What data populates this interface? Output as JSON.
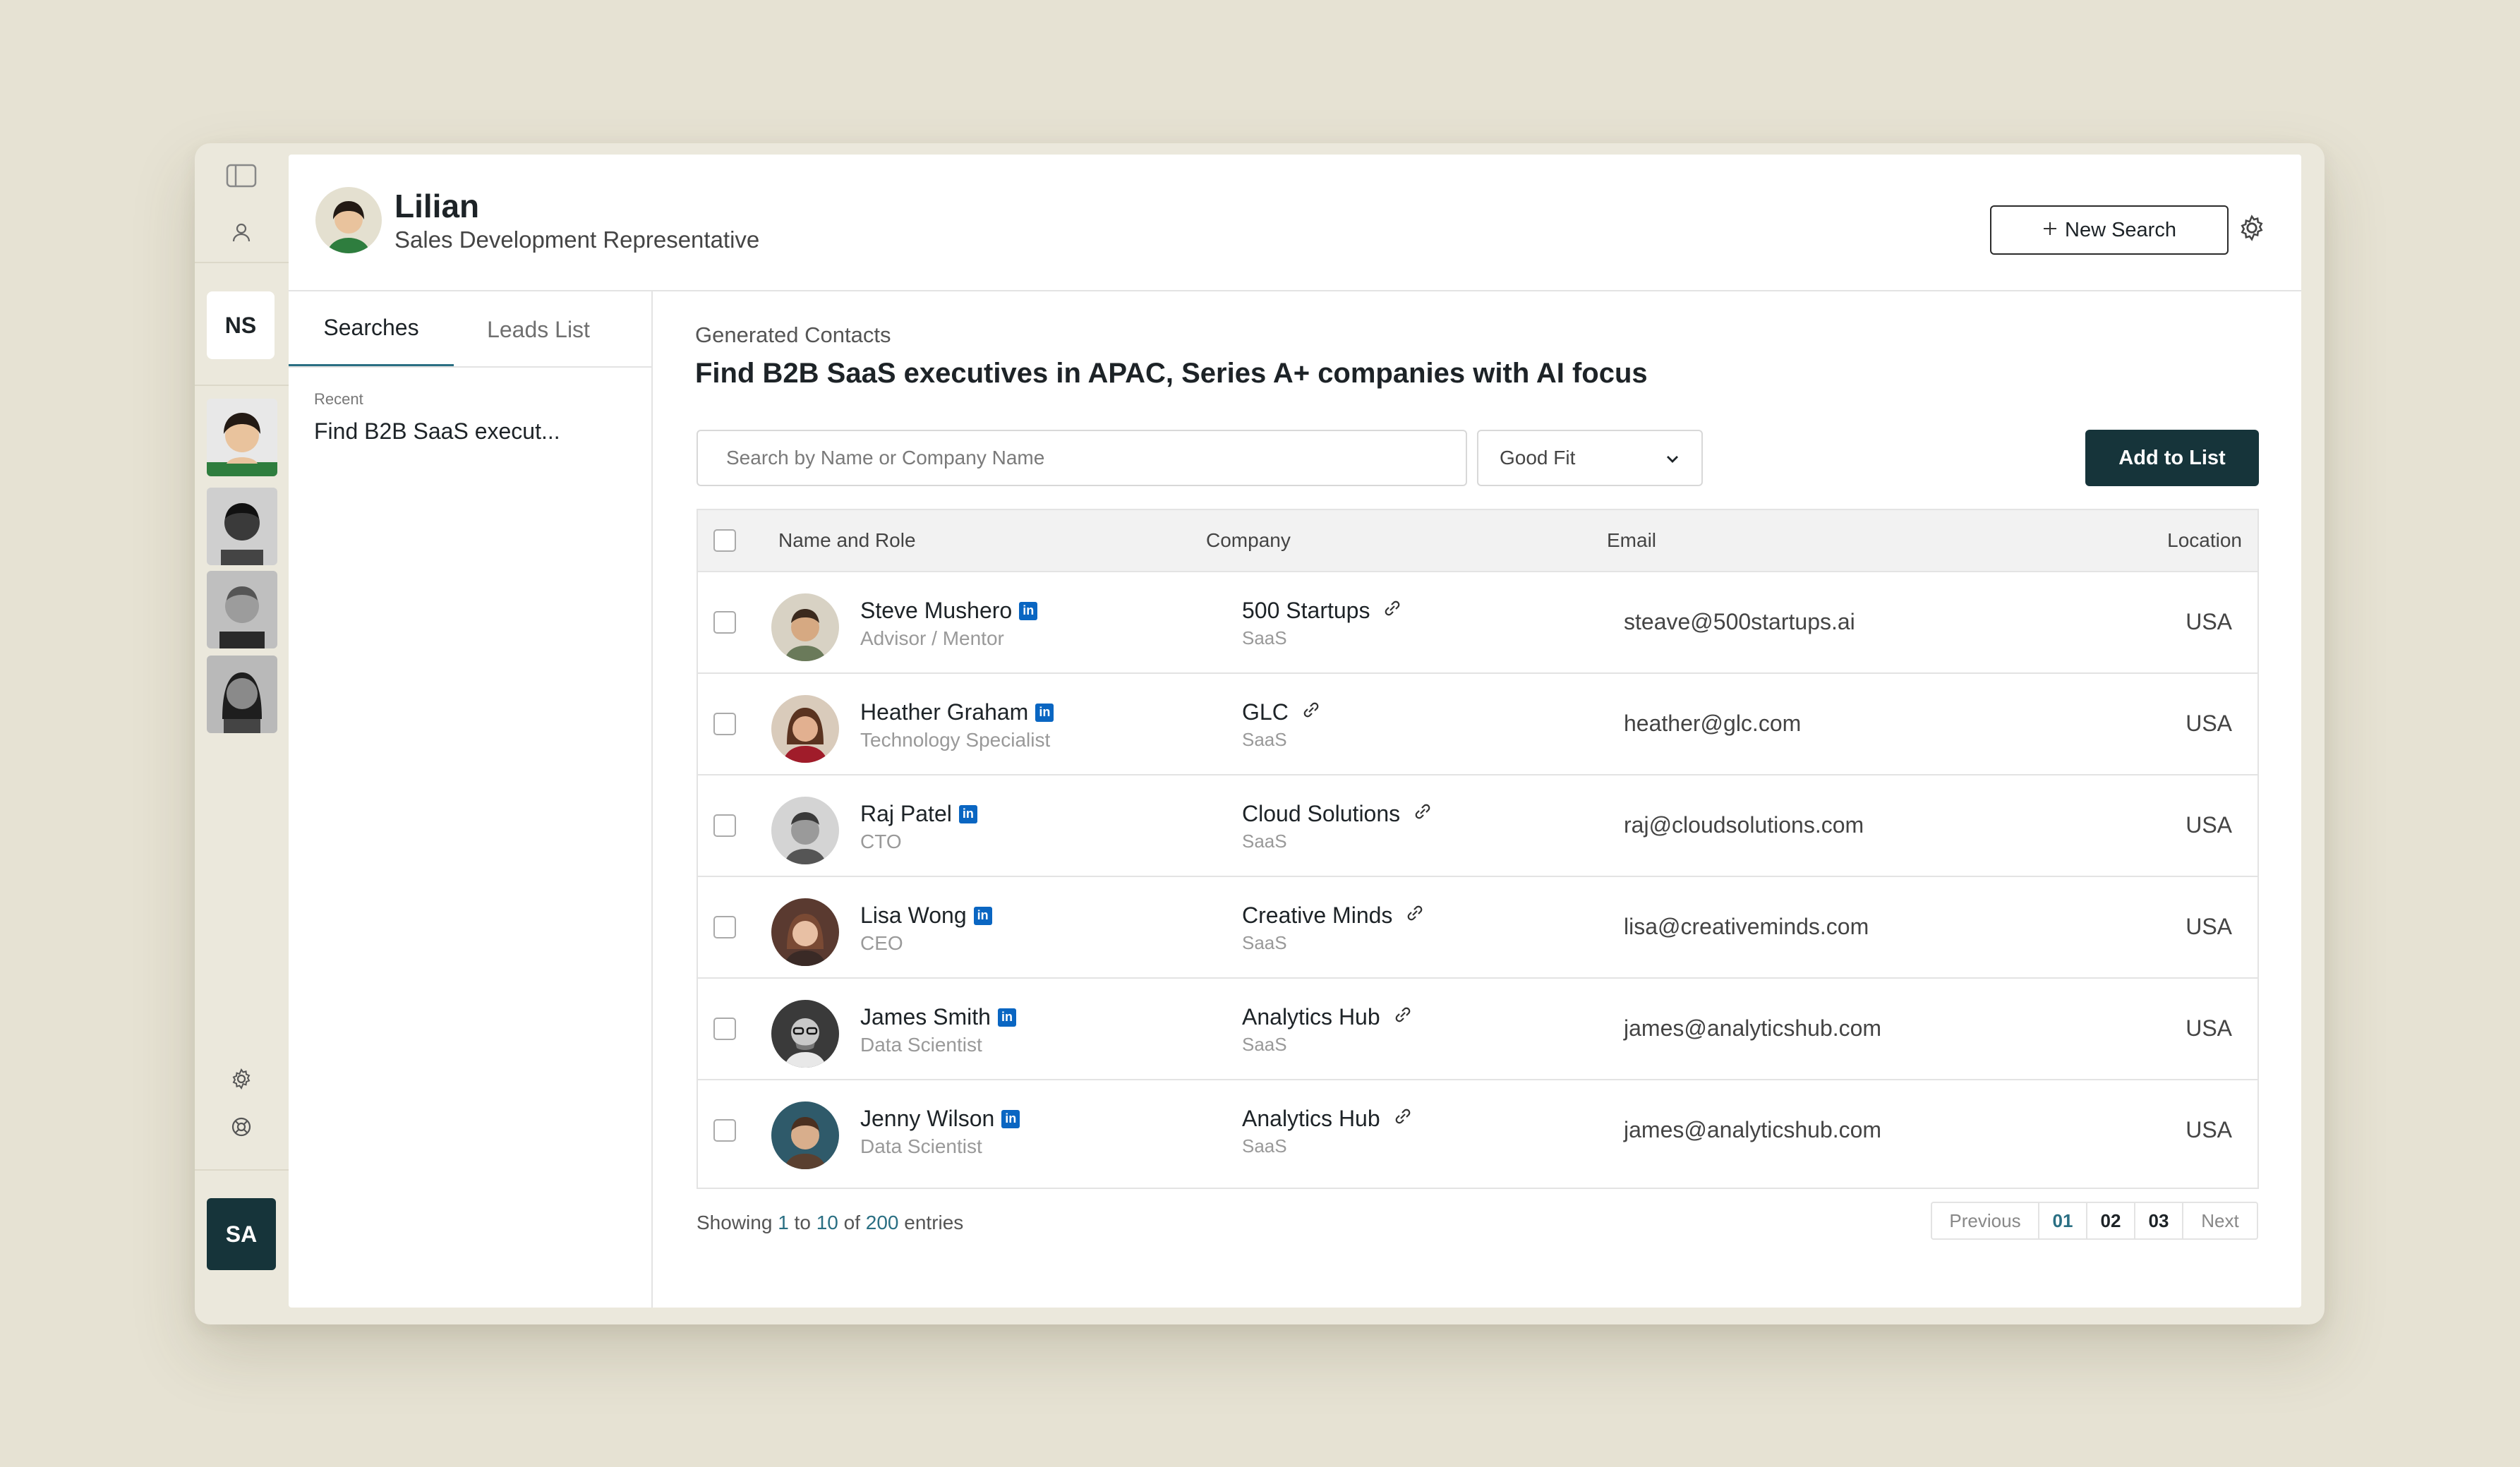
{
  "user": {
    "name": "Lilian",
    "role": "Sales Development Representative"
  },
  "header": {
    "new_search_label": "New Search"
  },
  "rail": {
    "ns_badge": "NS",
    "sa_badge": "SA"
  },
  "left_pane": {
    "tabs": [
      "Searches",
      "Leads List"
    ],
    "recent_label": "Recent",
    "recent_item": "Find B2B SaaS execut..."
  },
  "content": {
    "section_label": "Generated Contacts",
    "title": "Find B2B SaaS executives in APAC, Series A+ companies with AI focus",
    "search_placeholder": "Search by Name or Company Name",
    "fit_filter": "Good Fit",
    "add_button": "Add to List"
  },
  "table": {
    "headers": [
      "Name and Role",
      "Company",
      "Email",
      "Location"
    ],
    "rows": [
      {
        "name": "Steve Mushero",
        "role": "Advisor / Mentor",
        "company": "500 Startups",
        "industry": "SaaS",
        "email": "steave@500startups.ai",
        "location": "USA"
      },
      {
        "name": "Heather Graham",
        "role": "Technology Specialist",
        "company": "GLC",
        "industry": "SaaS",
        "email": "heather@glc.com",
        "location": "USA"
      },
      {
        "name": "Raj Patel",
        "role": "CTO",
        "company": "Cloud Solutions",
        "industry": "SaaS",
        "email": "raj@cloudsolutions.com",
        "location": "USA"
      },
      {
        "name": "Lisa Wong",
        "role": "CEO",
        "company": "Creative Minds",
        "industry": "SaaS",
        "email": "lisa@creativeminds.com",
        "location": "USA"
      },
      {
        "name": "James Smith",
        "role": "Data Scientist",
        "company": "Analytics Hub",
        "industry": "SaaS",
        "email": "james@analyticshub.com",
        "location": "USA"
      },
      {
        "name": "Jenny Wilson",
        "role": "Data Scientist",
        "company": "Analytics Hub",
        "industry": "SaaS",
        "email": "james@analyticshub.com",
        "location": "USA"
      }
    ]
  },
  "footer": {
    "showing": "Showing",
    "from": "1",
    "to_word": "to",
    "to": "10",
    "of_word": "of",
    "total": "200",
    "entries": "entries"
  },
  "pagination": {
    "previous": "Previous",
    "pages": [
      "01",
      "02",
      "03"
    ],
    "next": "Next"
  },
  "icons": {
    "linkedin": "in"
  },
  "colors": {
    "accent": "#2a6f83",
    "primary_button": "#16343a",
    "background": "#e6e2d3",
    "linkedin": "#0a66c2"
  }
}
